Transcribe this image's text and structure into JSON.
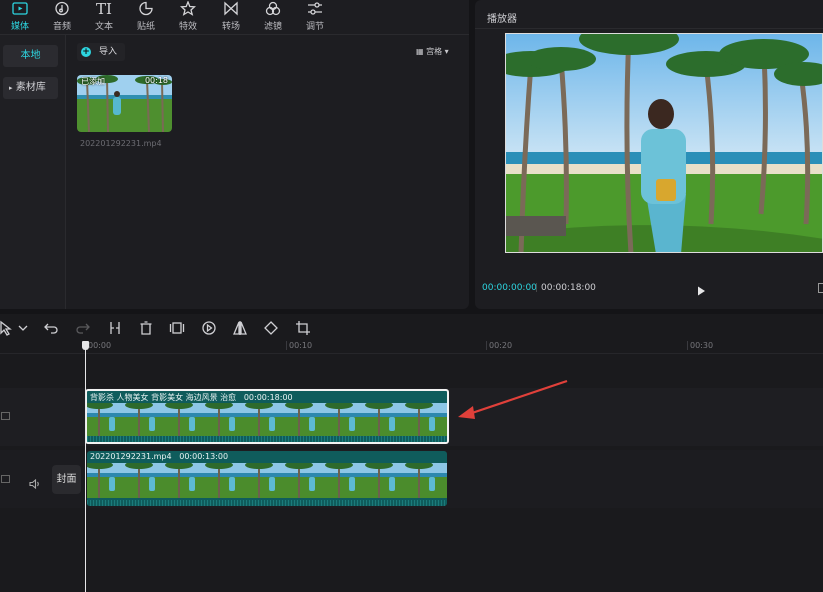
{
  "toolbar": {
    "items": [
      {
        "label": "媒体",
        "icon": "media-icon",
        "active": true
      },
      {
        "label": "音频",
        "icon": "audio-icon"
      },
      {
        "label": "文本",
        "icon": "text-icon"
      },
      {
        "label": "贴纸",
        "icon": "sticker-icon"
      },
      {
        "label": "特效",
        "icon": "effects-icon"
      },
      {
        "label": "转场",
        "icon": "transition-icon"
      },
      {
        "label": "滤镜",
        "icon": "filter-icon"
      },
      {
        "label": "调节",
        "icon": "adjust-icon"
      }
    ],
    "text_icon_glyph": "TI"
  },
  "sidebar": {
    "local": "本地",
    "library": "素材库"
  },
  "media": {
    "import_label": "导入",
    "view_label": "宫格",
    "item": {
      "added_tag": "已添加",
      "duration": "00:18",
      "filename": "202201292231.mp4"
    }
  },
  "player": {
    "title": "播放器",
    "current_time": "00:00:00:00",
    "total_time": "00:00:18:00"
  },
  "timeline": {
    "ruler_labels": [
      "00:00",
      "00:10",
      "00:20",
      "00:30"
    ],
    "cover_label": "封面",
    "clips": [
      {
        "title": "背影杀 人物美女  背影美女 海边风景 治愈",
        "duration": "00:00:18:00"
      },
      {
        "title": "202201292231.mp4",
        "duration": "00:00:13:00"
      }
    ]
  },
  "colors": {
    "accent": "#2dd5e0",
    "clip_bg": "#0f5c5c",
    "arrow": "#e0403a"
  }
}
